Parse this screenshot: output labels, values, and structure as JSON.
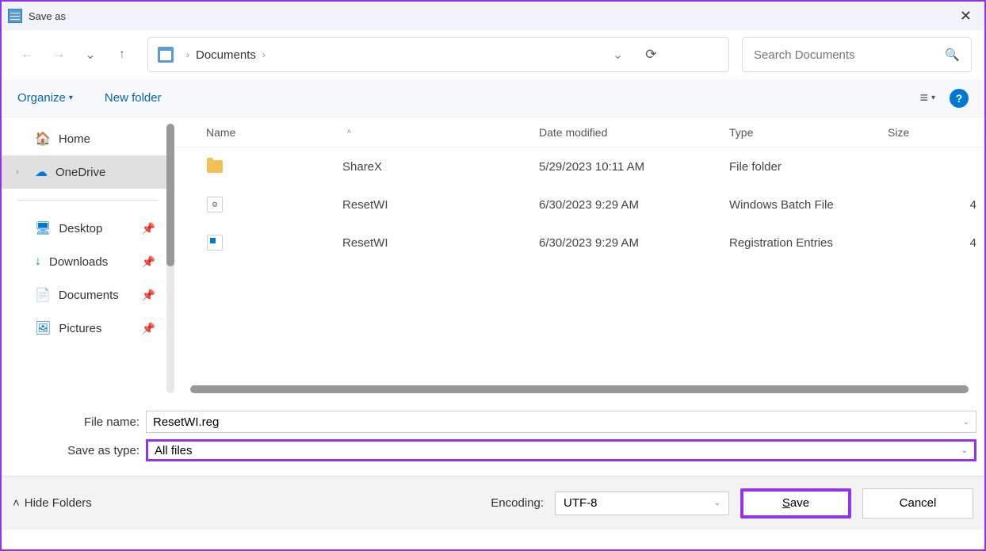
{
  "titlebar": {
    "title": "Save as"
  },
  "address": {
    "location": "Documents"
  },
  "search": {
    "placeholder": "Search Documents"
  },
  "toolbar": {
    "organize": "Organize",
    "new_folder": "New folder"
  },
  "sidebar": {
    "items": [
      {
        "label": "Home",
        "icon": "home"
      },
      {
        "label": "OneDrive",
        "icon": "cloud",
        "selected": true,
        "expandable": true
      },
      {
        "label": "Desktop",
        "icon": "desktop",
        "pinned": true
      },
      {
        "label": "Downloads",
        "icon": "downloads",
        "pinned": true
      },
      {
        "label": "Documents",
        "icon": "documents",
        "pinned": true
      },
      {
        "label": "Pictures",
        "icon": "pictures",
        "pinned": true
      }
    ]
  },
  "columns": {
    "name": "Name",
    "date": "Date modified",
    "type": "Type",
    "size": "Size"
  },
  "files": [
    {
      "name": "ShareX",
      "date": "5/29/2023 10:11 AM",
      "type": "File folder",
      "size": "",
      "icon": "folder"
    },
    {
      "name": "ResetWI",
      "date": "6/30/2023 9:29 AM",
      "type": "Windows Batch File",
      "size": "4",
      "icon": "bat"
    },
    {
      "name": "ResetWI",
      "date": "6/30/2023 9:29 AM",
      "type": "Registration Entries",
      "size": "4",
      "icon": "reg"
    }
  ],
  "inputs": {
    "filename_label": "File name:",
    "filename_value": "ResetWI.reg",
    "saveas_label": "Save as type:",
    "saveas_value": "All files"
  },
  "footer": {
    "hide_folders": "Hide Folders",
    "encoding_label": "Encoding:",
    "encoding_value": "UTF-8",
    "save": "Save",
    "cancel": "Cancel"
  }
}
